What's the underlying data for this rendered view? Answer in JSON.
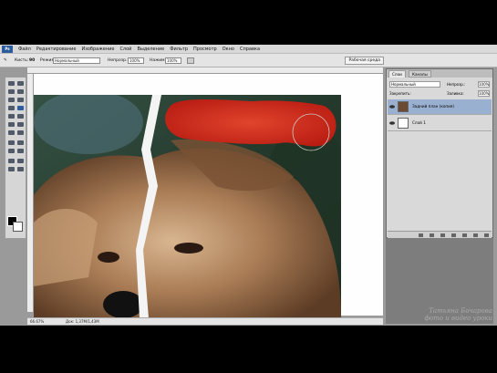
{
  "menu": {
    "items": [
      "Файл",
      "Редактирование",
      "Изображение",
      "Слой",
      "Выделение",
      "Фильтр",
      "Просмотр",
      "Окно",
      "Справка"
    ]
  },
  "options": {
    "brush_label": "Кисть:",
    "brush_size": "90",
    "mode_label": "Режим:",
    "mode_value": "Нормальный",
    "opacity_label": "Непрозр.:",
    "opacity_value": "100%",
    "flow_label": "Нажим:",
    "flow_value": "100%",
    "workspace_label": "Рабочая среда"
  },
  "toolbox": {
    "tools": [
      "move-tool",
      "marquee-tool",
      "lasso-tool",
      "magic-wand-tool",
      "crop-tool",
      "slice-tool",
      "healing-brush-tool",
      "brush-tool",
      "clone-stamp-tool",
      "history-brush-tool",
      "eraser-tool",
      "gradient-tool",
      "blur-tool",
      "dodge-tool",
      "path-selection-tool",
      "type-tool",
      "pen-tool",
      "shape-tool",
      "notes-tool",
      "eyedropper-tool",
      "hand-tool",
      "zoom-tool"
    ]
  },
  "document": {
    "zoom": "66.67%",
    "info": "Док: 1,37М/1,43М"
  },
  "layers": {
    "tabs": [
      "Слои",
      "Каналы"
    ],
    "blend_mode": "Нормальный",
    "opacity_label": "Непрозр.:",
    "opacity_value": "100%",
    "lock_label": "Закрепить:",
    "fill_label": "Заливка:",
    "fill_value": "100%",
    "rows": [
      {
        "name": "Задний план (копия)",
        "selected": true
      },
      {
        "name": "Слой 1",
        "selected": false
      }
    ]
  },
  "watermark": {
    "line1": "Татьяна Бочарова",
    "line2": "фото и видео уроки"
  },
  "colors": {
    "foreground": "#000000",
    "background": "#ffffff",
    "red_patch": "#e2281a"
  }
}
